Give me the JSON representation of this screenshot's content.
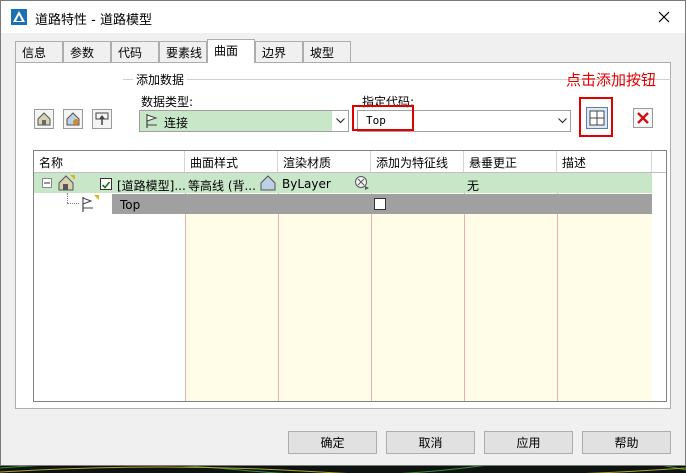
{
  "window": {
    "title": "道路特性 - 道路模型"
  },
  "tabs": [
    {
      "label": "信息"
    },
    {
      "label": "参数"
    },
    {
      "label": "代码"
    },
    {
      "label": "要素线"
    },
    {
      "label": "曲面"
    },
    {
      "label": "边界"
    },
    {
      "label": "坡型"
    }
  ],
  "add_data": {
    "group_title": "添加数据",
    "data_type_label": "数据类型:",
    "data_type_value": "连接",
    "code_label": "指定代码:",
    "code_value": "Top"
  },
  "annotation": "点击添加按钮",
  "table": {
    "columns": [
      "名称",
      "曲面样式",
      "渲染材质",
      "添加为特征线",
      "悬垂更正",
      "描述"
    ],
    "rows": [
      {
        "name": "[道路模型]...",
        "style": "等高线 (背...",
        "material": "ByLayer",
        "add_feature": "",
        "overhang": "无",
        "desc": ""
      },
      {
        "name": "Top",
        "style": "",
        "material": "",
        "add_feature": "",
        "overhang": "",
        "desc": ""
      }
    ]
  },
  "buttons": {
    "ok": "确定",
    "cancel": "取消",
    "apply": "应用",
    "help": "帮助"
  },
  "colors": {
    "accent_red": "#e00000",
    "row_green": "#c8e6c8",
    "row_gray": "#a0a0a0"
  }
}
